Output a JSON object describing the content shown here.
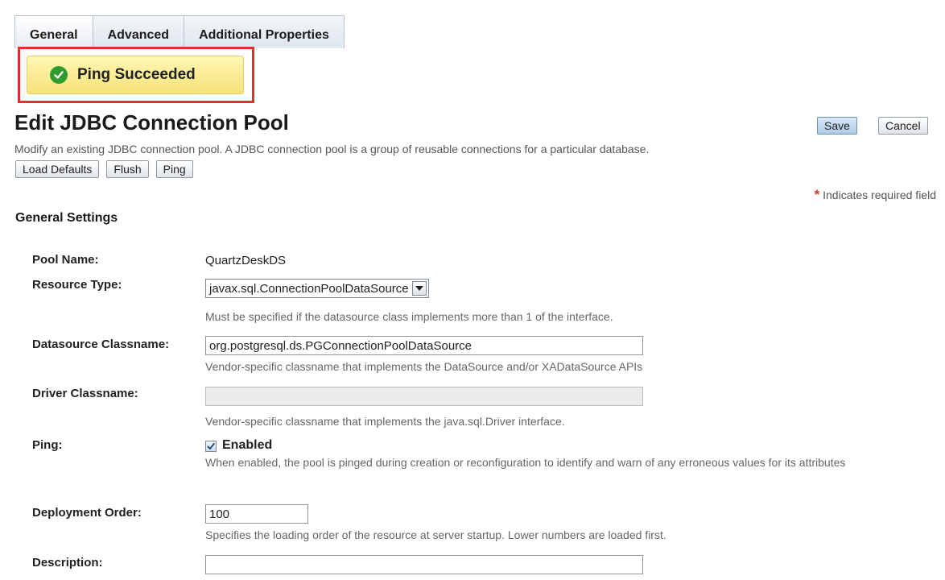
{
  "tabs": [
    {
      "label": "General",
      "active": true
    },
    {
      "label": "Advanced",
      "active": false
    },
    {
      "label": "Additional Properties",
      "active": false
    }
  ],
  "alert": {
    "text": "Ping Succeeded",
    "icon": "check-circle-icon",
    "color": "#2e9b2f"
  },
  "page": {
    "title": "Edit JDBC Connection Pool",
    "description": "Modify an existing JDBC connection pool. A JDBC connection pool is a group of reusable connections for a particular database.",
    "save_label": "Save",
    "cancel_label": "Cancel",
    "load_defaults_label": "Load Defaults",
    "flush_label": "Flush",
    "ping_label": "Ping",
    "required_star": "*",
    "required_text": "Indicates required field"
  },
  "section": {
    "title": "General Settings"
  },
  "fields": {
    "pool_name": {
      "label": "Pool Name:",
      "value": "QuartzDeskDS"
    },
    "resource_type": {
      "label": "Resource Type:",
      "value": "javax.sql.ConnectionPoolDataSource",
      "help": "Must be specified if the datasource class implements more than 1 of the interface."
    },
    "datasource_classname": {
      "label": "Datasource Classname:",
      "value": "org.postgresql.ds.PGConnectionPoolDataSource",
      "help": "Vendor-specific classname that implements the DataSource and/or XADataSource APIs"
    },
    "driver_classname": {
      "label": "Driver Classname:",
      "value": "",
      "help": "Vendor-specific classname that implements the java.sql.Driver interface."
    },
    "ping": {
      "label": "Ping:",
      "checkbox_label": "Enabled",
      "checked": true,
      "help": "When enabled, the pool is pinged during creation or reconfiguration to identify and warn of any erroneous values for its attributes"
    },
    "deployment_order": {
      "label": "Deployment Order:",
      "value": "100",
      "help": "Specifies the loading order of the resource at server startup. Lower numbers are loaded first."
    },
    "description": {
      "label": "Description:",
      "value": ""
    }
  }
}
